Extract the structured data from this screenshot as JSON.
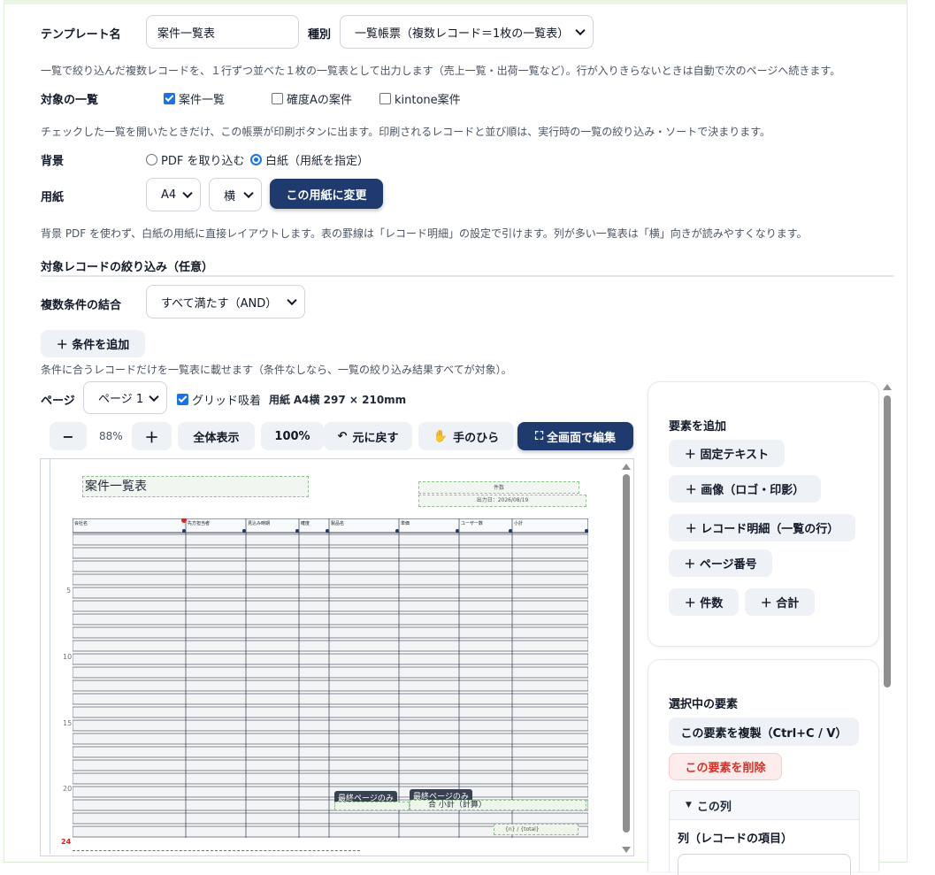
{
  "template": {
    "name_label": "テンプレート名",
    "name_value": "案件一覧表",
    "type_label": "種別",
    "type_value": "一覧帳票（複数レコード＝1枚の一覧表）",
    "type_desc": "一覧で絞り込んだ複数レコードを、１行ずつ並べた１枚の一覧表として出力します（売上一覧・出荷一覧など）。行が入りきらないときは自動で次のページへ続きます。"
  },
  "target_lists": {
    "label": "対象の一覧",
    "items": [
      {
        "label": "案件一覧",
        "checked": true
      },
      {
        "label": "確度Aの案件",
        "checked": false
      },
      {
        "label": "kintone案件",
        "checked": false
      }
    ],
    "desc": "チェックした一覧を開いたときだけ、この帳票が印刷ボタンに出ます。印刷されるレコードと並び順は、実行時の一覧の絞り込み・ソートで決まります。"
  },
  "background": {
    "label": "背景",
    "options": [
      {
        "label": "PDF を取り込む",
        "selected": false
      },
      {
        "label": "白紙（用紙を指定）",
        "selected": true
      }
    ]
  },
  "paper": {
    "label": "用紙",
    "size_value": "A4",
    "orientation_value": "横",
    "apply_label": "この用紙に変更",
    "desc": "背景 PDF を使わず、白紙の用紙に直接レイアウトします。表の罫線は「レコード明細」の設定で引けます。列が多い一覧表は「横」向きが読みやすくなります。"
  },
  "filter": {
    "section_title": "対象レコードの絞り込み（任意）",
    "combine_label": "複数条件の結合",
    "combine_value": "すべて満たす（AND）",
    "add_label": "＋ 条件を追加",
    "desc": "条件に合うレコードだけを一覧表に載せます（条件なしなら、一覧の絞り込み結果すべてが対象）。"
  },
  "page_bar": {
    "label": "ページ",
    "page_value": "ページ 1",
    "grid_label": "グリッド吸着",
    "grid_checked": true,
    "paper_info_prefix": "用紙",
    "paper_info": "A4横 297 × 210mm"
  },
  "toolbar": {
    "zoom_out": "−",
    "zoom_level": "88%",
    "zoom_in": "＋",
    "fit": "全体表示",
    "hundred": "100%",
    "undo": "元に戻す",
    "hand": "手のひら",
    "fullscreen": "全画面で編集"
  },
  "canvas": {
    "title_text": "案件一覧表",
    "count_label": "件数",
    "output_date": "出力日：2026/08/19",
    "columns": [
      "会社名",
      "先方担当者",
      "見込み時期",
      "確度",
      "製品名",
      "単価",
      "ユーザー数",
      "小計"
    ],
    "row_numbers": [
      "5",
      "10",
      "15",
      "20",
      "24"
    ],
    "last_page_tag_1": "最終ページのみ",
    "last_page_tag_2": "最終ページのみ",
    "total_text": "合  小計（計算）",
    "page_num_text": "{n} / {total}"
  },
  "add_panel": {
    "title": "要素を追加",
    "buttons": [
      "＋ 固定テキスト",
      "＋ 画像（ロゴ・印影）",
      "＋ レコード明細（一覧の行）",
      "＋ ページ番号",
      "＋ 件数",
      "＋ 合計"
    ]
  },
  "selected_panel": {
    "title": "選択中の要素",
    "duplicate": "この要素を複製（Ctrl+C / V）",
    "delete": "この要素を削除",
    "section": "この列",
    "field_label": "列（レコードの項目）"
  }
}
